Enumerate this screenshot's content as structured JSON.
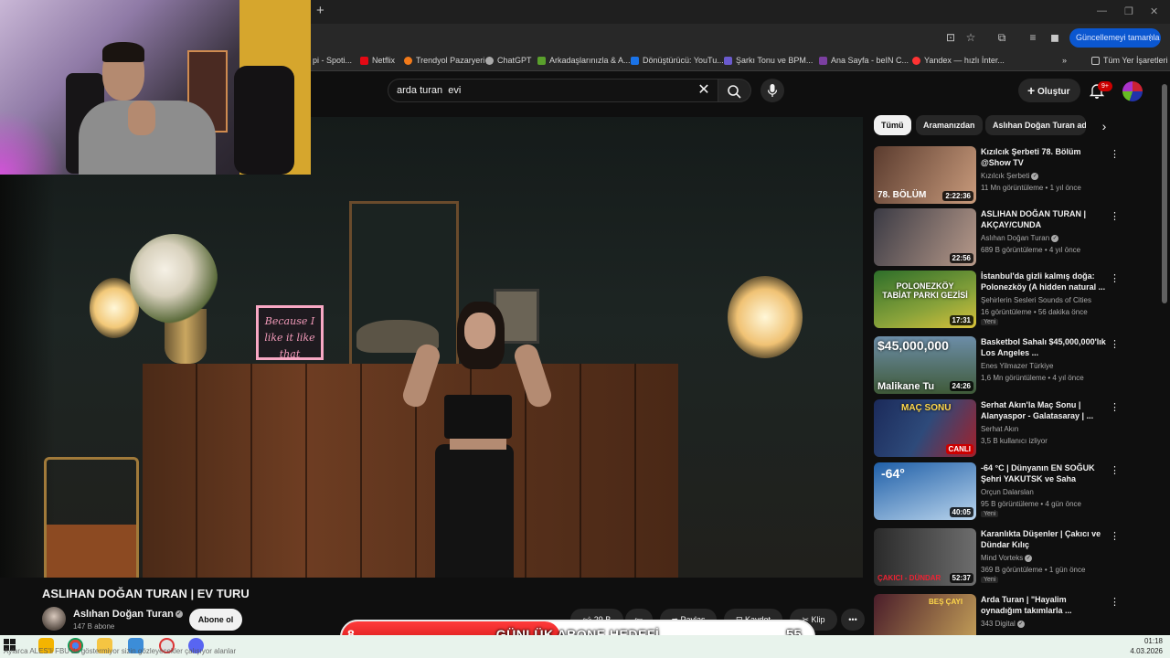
{
  "browser": {
    "update_button": "Güncellemeyi tamamla",
    "bookmarks": [
      {
        "label": "pi - Spoti...",
        "color": "#1db954"
      },
      {
        "label": "Netflix",
        "color": "#e50914"
      },
      {
        "label": "Trendyol Pazaryeri",
        "color": "#f27a1a"
      },
      {
        "label": "ChatGPT",
        "color": "#aaaaaa"
      },
      {
        "label": "Arkadaşlarınızla & A...",
        "color": "#5aa02c"
      },
      {
        "label": "Dönüştürücü: YouTu...",
        "color": "#1a73e8"
      },
      {
        "label": "Şarkı Tonu ve BPM...",
        "color": "#6a5acd"
      },
      {
        "label": "Ana Sayfa - beIN C...",
        "color": "#7b3fa0"
      },
      {
        "label": "Yandex — hızlı İnter...",
        "color": "#ff3333"
      }
    ],
    "bookmarks_more": "»",
    "all_bookmarks": "Tüm Yer İşaretleri"
  },
  "header": {
    "search_value": "arda turan  evi",
    "create_label": "Oluştur",
    "notification_badge": "9+"
  },
  "video": {
    "title": "ASLIHAN DOĞAN TURAN | EV TURU",
    "neon_sign": "Because I like it like that",
    "channel_name": "Aslıhan Doğan Turan",
    "subscribers": "147 B abone",
    "subscribe_label": "Abone ol",
    "like_count": "29 B",
    "share_label": "Paylaş",
    "save_label": "Kaydet",
    "clip_label": "Klip"
  },
  "chips": [
    "Tümü",
    "Aramanızdan",
    "Aslıhan Doğan Turan adı"
  ],
  "recommendations": [
    {
      "title": "Kızılcık Şerbeti 78. Bölüm @Show TV",
      "channel": "Kızılcık Şerbeti",
      "verified": true,
      "meta": "11 Mn görüntüleme • 1 yıl önce",
      "duration": "2:22:36",
      "thumb_text": "78. BÖLÜM",
      "badge": "",
      "colors": [
        "#5a3b2e",
        "#c99b7c"
      ]
    },
    {
      "title": "ASLIHAN DOĞAN TURAN | AKÇAY/CUNDA",
      "channel": "Aslıhan Doğan Turan",
      "verified": true,
      "meta": "689 B görüntüleme • 4 yıl önce",
      "duration": "22:56",
      "thumb_text": "",
      "badge": "",
      "colors": [
        "#3a3a44",
        "#b89a8a"
      ]
    },
    {
      "title": "İstanbul'da gizli kalmış doğa: Polonezköy (A hidden natural ...",
      "channel": "Şehirlerin Sesleri Sounds of Cities",
      "verified": false,
      "meta": "16 görüntüleme • 56 dakika önce",
      "duration": "17:31",
      "thumb_text": "POLONEZKÖY TABİAT PARKI GEZİSİ",
      "badge": "Yeni",
      "colors": [
        "#2d6e2a",
        "#d9c23a"
      ]
    },
    {
      "title": "Basketbol Sahalı $45,000,000'lık Los Angeles ...",
      "channel": "Enes Yilmazer Türkiye",
      "verified": false,
      "meta": "1,6 Mn görüntüleme • 4 yıl önce",
      "duration": "24:26",
      "thumb_text": "$45,000,000",
      "thumb_text2": "Malikane Tu",
      "badge": "",
      "colors": [
        "#6c8da8",
        "#3f5a38"
      ]
    },
    {
      "title": "Serhat Akın'la Maç Sonu | Alanyaspor - Galatasaray | ...",
      "channel": "Serhat Akın",
      "verified": false,
      "meta": "3,5 B kullanıcı izliyor",
      "duration": "CANLI",
      "thumb_text": "MAÇ SONU",
      "badge": "",
      "colors": [
        "#1b2a5a",
        "#a3202a"
      ]
    },
    {
      "title": "-64 °C | Dünyanın EN SOĞUK Şehri YAKUTSK ve Saha Türkleri",
      "channel": "Orçun Dalarslan",
      "verified": false,
      "meta": "95 B görüntüleme • 4 gün önce",
      "duration": "40:05",
      "thumb_text": "-64°",
      "badge": "Yeni",
      "colors": [
        "#1f5fa8",
        "#b9d4ec"
      ]
    },
    {
      "title": "Karanlıkta Düşenler | Çakıcı ve Dündar Kılıç",
      "channel": "Mind Vorteks",
      "verified": true,
      "meta": "369 B görüntüleme • 1 gün önce",
      "duration": "52:37",
      "thumb_text": "ÇAKICI - DÜNDAR",
      "badge": "Yeni",
      "colors": [
        "#2a2a2a",
        "#6d6d6d"
      ]
    },
    {
      "title": "Arda Turan | \"Hayalim oynadığım takımlarla ...",
      "channel": "343 Digital",
      "verified": true,
      "meta": "",
      "duration": "",
      "thumb_text": "BEŞ ÇAYI",
      "badge": "",
      "colors": [
        "#4a1d2a",
        "#c8a45a"
      ]
    }
  ],
  "goal": {
    "current": "8",
    "label": "GÜNLÜK ABONE HEDEFİ",
    "target": "55",
    "progress_fraction": 0.145
  },
  "taskbar": {
    "ticker": "Aylarca ALES'li FBU'da göstermiyor sizin gözleyecekler çalışıyor alanlar",
    "time": "01:18",
    "date": "4.03.2026"
  },
  "colors": {
    "accent_red": "#cc0000",
    "chrome_blue": "#0b57d0",
    "yt_bg": "#0f0f0f"
  }
}
